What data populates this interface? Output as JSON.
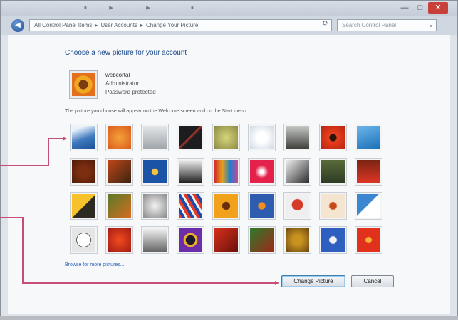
{
  "window": {
    "title_icons": [
      "folder-icon",
      "arrow-icon",
      "arrow-icon",
      "help-icon"
    ],
    "controls": {
      "minimize": "—",
      "maximize": "□",
      "close": "✕"
    }
  },
  "address_bar": {
    "path": [
      "All Control Panel Items",
      "User Accounts",
      "Change Your Picture"
    ],
    "search_placeholder": "Search Control Panel"
  },
  "page": {
    "heading": "Choose a new picture for your account",
    "user": {
      "name": "webcortal",
      "role": "Administrator",
      "password": "Password protected"
    },
    "note": "The picture you choose will appear on the Welcome screen and on the Start menu",
    "browse_link": "Browse for more pictures...",
    "buttons": {
      "change": "Change Picture",
      "cancel": "Cancel"
    }
  },
  "pictures": [
    {
      "name": "waterfall",
      "bg": "linear-gradient(160deg,#e9f2fb 15%,#3f79bf 55%,#1c4f94)"
    },
    {
      "name": "orange-flower",
      "bg": "radial-gradient(circle,#f3a23a,#dc5a1c)"
    },
    {
      "name": "chess-piece",
      "bg": "linear-gradient(#e4e6e8,#9fa4a9)"
    },
    {
      "name": "black-guitar",
      "bg": "linear-gradient(135deg,#1d1d1f 45%,#b73a2d 47%,#1d1d1f 55%)"
    },
    {
      "name": "tennis-ball",
      "bg": "radial-gradient(circle,#d6d57a,#8c8a44)"
    },
    {
      "name": "dandelion",
      "bg": "radial-gradient(circle,#ffffff 30%,#cfd9e3)"
    },
    {
      "name": "horse",
      "bg": "linear-gradient(#c7c9c6,#3d3d3a)"
    },
    {
      "name": "red-flower",
      "bg": "radial-gradient(circle,#2a1508 20%,#e8401c 24%,#b72512)"
    },
    {
      "name": "butterfly",
      "bg": "linear-gradient(160deg,#6db6ea,#1a6fb6)"
    },
    {
      "name": "gingko",
      "bg": "radial-gradient(circle,#7e2e10 30%,#4c1c08)"
    },
    {
      "name": "leaves",
      "bg": "linear-gradient(135deg,#c24619,#3a2410)"
    },
    {
      "name": "blue-flower",
      "bg": "radial-gradient(circle,#f5c341 18%,#1b53a7 22%)"
    },
    {
      "name": "dancer",
      "bg": "linear-gradient(#eeeeee,#1b1b1b)"
    },
    {
      "name": "crayons",
      "bg": "linear-gradient(90deg,#d22929,#e6a11c,#1c7fd1,#c84993)"
    },
    {
      "name": "pink-star",
      "bg": "radial-gradient(circle,#ffffff 10%,#e4214a 40%)"
    },
    {
      "name": "sketch",
      "bg": "linear-gradient(135deg,#f1f1f1,#2a2a2a)"
    },
    {
      "name": "monkey",
      "bg": "linear-gradient(#5a6b3a,#2c3a23)"
    },
    {
      "name": "poppies",
      "bg": "linear-gradient(#7b2414,#e03525)"
    },
    {
      "name": "yellow-leaf",
      "bg": "linear-gradient(135deg,#f6c12b 50%,#2d2a22 52%)"
    },
    {
      "name": "autumn",
      "bg": "linear-gradient(135deg,#5a7a2a,#d46d1d)"
    },
    {
      "name": "skull",
      "bg": "radial-gradient(circle,#f2f2f2,#8a8a8a)"
    },
    {
      "name": "stripes",
      "bg": "repeating-linear-gradient(60deg,#e23b27 0 4px,#1d4aa8 4px 8px,#f0f0f0 8px 11px)"
    },
    {
      "name": "sunflower",
      "bg": "radial-gradient(circle,#6b2d0b 22%,#f1a21a 26%)"
    },
    {
      "name": "fish",
      "bg": "radial-gradient(circle,#f08f20 20%,#2e5db0 24%)"
    },
    {
      "name": "balloon",
      "bg": "radial-gradient(circle at 50% 45%,#d63a2a 30%,#efefef 34%)"
    },
    {
      "name": "cupcake",
      "bg": "radial-gradient(circle,#c74a1a 20%,#f4e4d0 26%)"
    },
    {
      "name": "snowy",
      "bg": "linear-gradient(135deg,#3a86d0 45%,#ffffff 48%)"
    },
    {
      "name": "soccer-ball",
      "bg": "radial-gradient(circle,#ffffff 40%,#222222 42%,#e5e5e5 46%)"
    },
    {
      "name": "red-petals",
      "bg": "radial-gradient(circle,#f44b1e,#a11d14)"
    },
    {
      "name": "soccer-team",
      "bg": "linear-gradient(#f3f3f3,#666666)"
    },
    {
      "name": "purple-frame",
      "bg": "radial-gradient(circle,#1c1c2c 28%,#f2b02a 30% 40%,#6b2da8 44%)"
    },
    {
      "name": "red-leaf",
      "bg": "linear-gradient(135deg,#d7301b,#6a110a)"
    },
    {
      "name": "green-leaf",
      "bg": "linear-gradient(135deg,#2f7a2a,#9b2a1a)"
    },
    {
      "name": "crown",
      "bg": "radial-gradient(circle,#c89220 28%,#6b4712)"
    },
    {
      "name": "robot",
      "bg": "radial-gradient(circle,#f2f2f2 20%,#2d5ec0 26%)"
    },
    {
      "name": "red-daisy",
      "bg": "radial-gradient(circle,#f6b232 16%,#e1311d 22%)"
    }
  ]
}
